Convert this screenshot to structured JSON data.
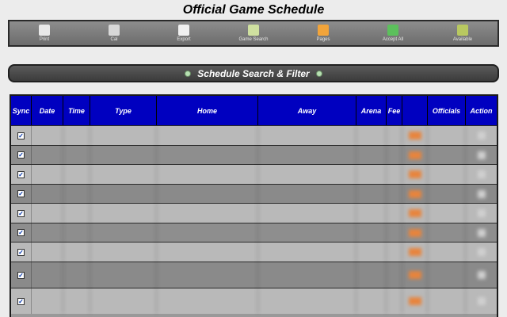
{
  "title": "Official Game Schedule",
  "toolbar": [
    {
      "label": "Print",
      "icon": "printer-icon",
      "color": "#e8e8e8"
    },
    {
      "label": "Cal",
      "icon": "calendar-icon",
      "color": "#d8d8d8"
    },
    {
      "label": "Export",
      "icon": "document-icon",
      "color": "#f0f0f0"
    },
    {
      "label": "Game Search",
      "icon": "ball-icon",
      "color": "#cfe0a0"
    },
    {
      "label": "Pages",
      "icon": "folder-icon",
      "color": "#f2a43a"
    },
    {
      "label": "Accept All",
      "icon": "thumbs-up-icon",
      "color": "#5cc05c"
    },
    {
      "label": "Available",
      "icon": "pencil-icon",
      "color": "#b8c860"
    }
  ],
  "filter_bar": {
    "label": "Schedule Search & Filter"
  },
  "table": {
    "columns": [
      "Sync",
      "Date",
      "Time",
      "Type",
      "Home",
      "Away",
      "Arena",
      "Fee",
      "",
      "Officials",
      "Action"
    ],
    "check_mark": "✓",
    "row_colors": [
      "#b9b9b9",
      "#8e8e8e",
      "#b9b9b9",
      "#8a8a8a",
      "#b9b9b9",
      "#8e8e8e",
      "#b9b9b9",
      "#8a8a8a",
      "#b9b9b9"
    ],
    "row_count": 9
  }
}
